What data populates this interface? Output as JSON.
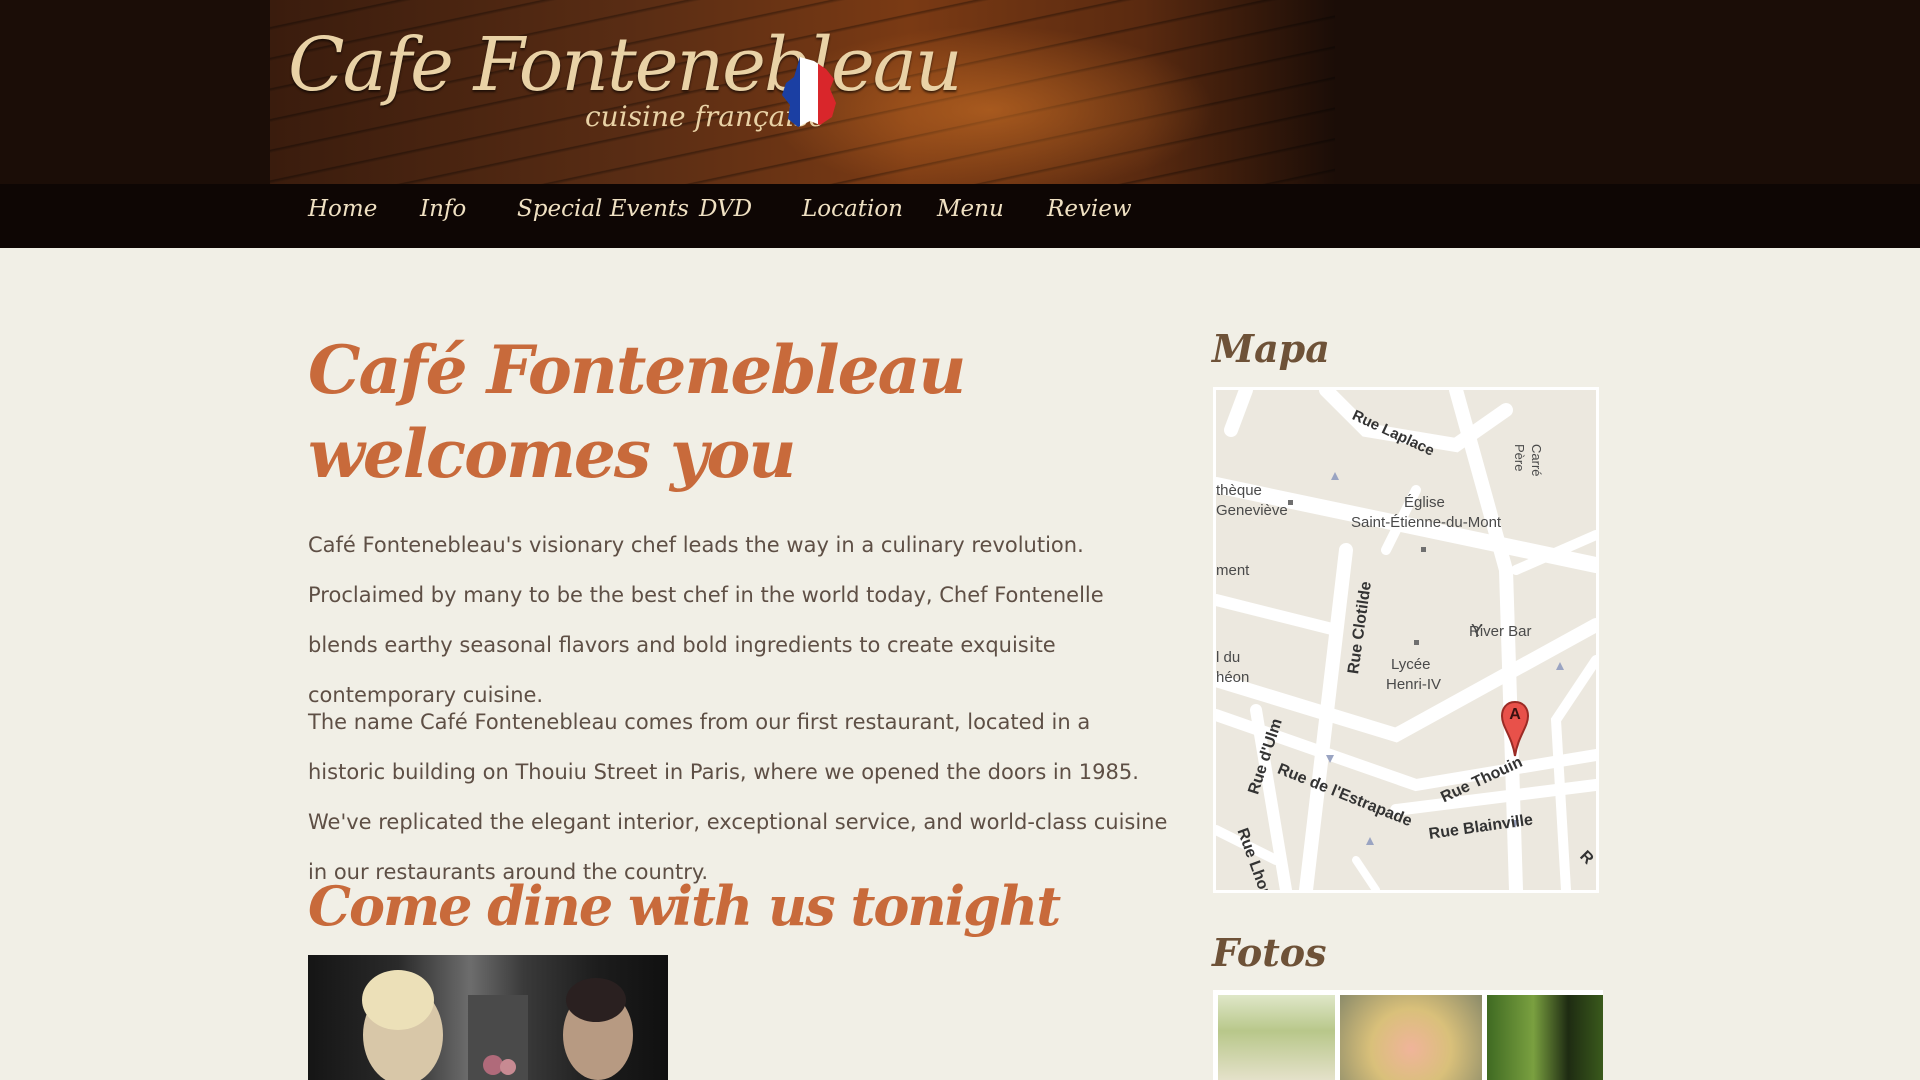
{
  "header": {
    "logo_title": "Cafe Fontenebleau",
    "logo_subtitle": "cuisine française"
  },
  "nav": {
    "items": [
      "Home",
      "Info",
      "Special Events",
      "DVD",
      "Location",
      "Menu",
      "Review"
    ]
  },
  "main": {
    "heading": "Café Fontenebleau welcomes you",
    "paragraph1": "Café Fontenebleau's visionary chef leads the way in a culinary revolution. Proclaimed by many to be the best chef in the world today, Chef Fontenelle blends earthy seasonal flavors and bold ingredients to create exquisite contemporary cuisine.",
    "paragraph2": "The name Café Fontenebleau comes from our first restaurant, located in a historic building on Thouiu Street in Paris, where we opened the doors in 1985. We've replicated the elegant interior, exceptional service, and world-class cuisine in our restaurants around the country.",
    "subheading": "Come dine with us tonight"
  },
  "sidebar": {
    "map_heading": "Mapa",
    "photos_heading": "Fotos",
    "map_labels": {
      "rue_laplace": "Rue Laplace",
      "carre": "Carré",
      "pere": "Père",
      "theque": "thèque",
      "genevieve": "Geneviève",
      "eglise": "Église",
      "saint_etienne": "Saint-Étienne-du-Mont",
      "ment": "ment",
      "rue_clotilde": "Rue Clotilde",
      "river_bar": "River Bar",
      "du": "l du",
      "eon": "héon",
      "lycee": "Lycée",
      "henri": "Henri-IV",
      "rue_dulm": "Rue d'Ulm",
      "rue_estrapade": "Rue de l'Estrapade",
      "rue_thouin": "Rue Thouin",
      "rue_blainville": "Rue Blainville",
      "rue_lhomond": "Rue Lhomond",
      "marker": "A",
      "r_edge": "R"
    }
  },
  "colors": {
    "heading": "#c86a3b",
    "body_text": "#5e4f45",
    "page_bg": "#f1efe6",
    "nav_bg": "#0e0604",
    "side_heading": "#6e5238"
  }
}
